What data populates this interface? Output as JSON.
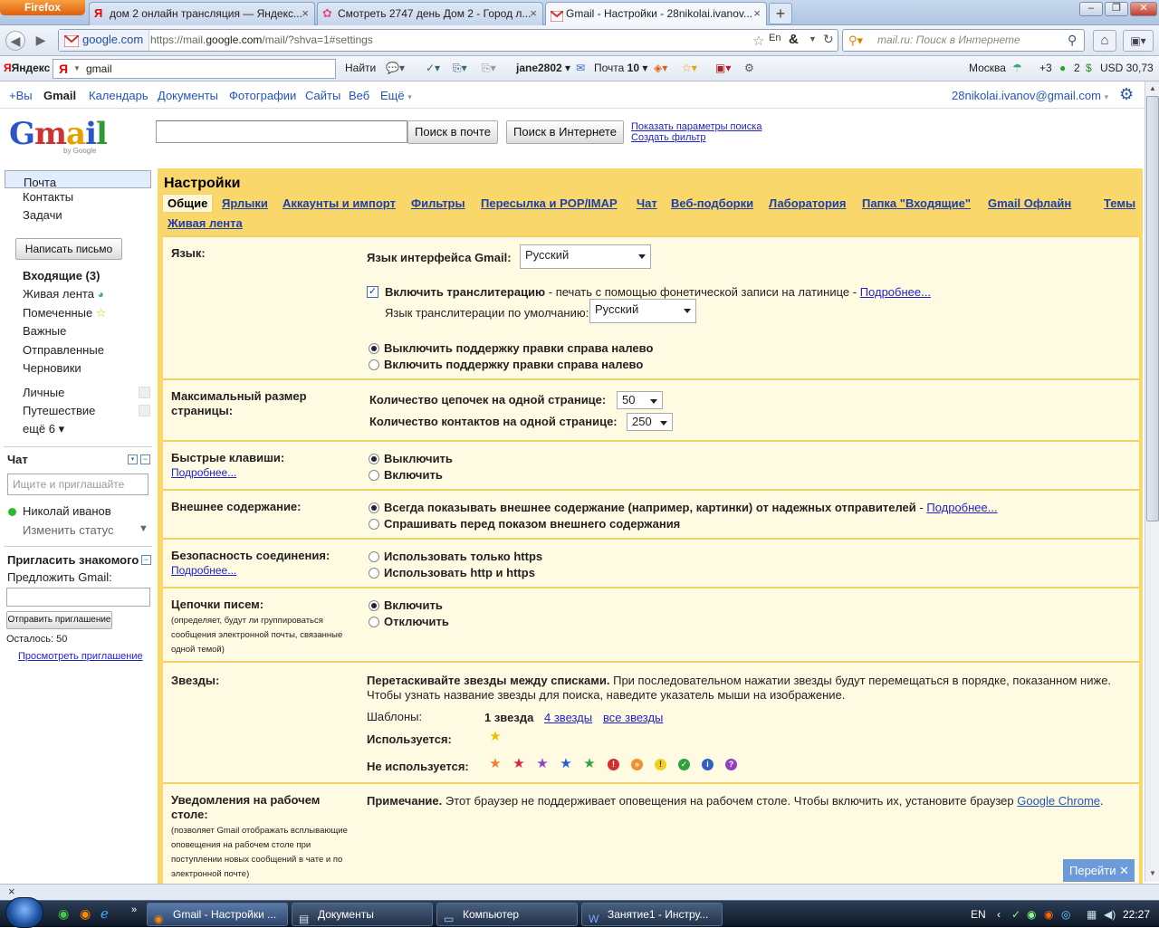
{
  "browser": {
    "app_button": "Firefox",
    "tabs": [
      {
        "label": "дом 2 онлайн трансляция — Яндекс...",
        "active": false
      },
      {
        "label": "Смотреть 2747 день Дом 2 - Город л...",
        "active": false
      },
      {
        "label": "Gmail - Настройки - 28nikolai.ivanov...",
        "active": true
      }
    ],
    "site_identity": "google.com",
    "url_prefix": "https://mail.",
    "url_host": "google.com",
    "url_path": "/mail/?shva=1#settings",
    "search_placeholder": "mail.ru: Поиск в Интернете"
  },
  "yandex_bar": {
    "brand": "Яндекс",
    "query": "gmail",
    "find": "Найти",
    "user": "jane2802",
    "mail": "Почта",
    "mail_count": "10",
    "city": "Москва",
    "temp": "+3",
    "traffic": "2",
    "currency": "USD 30,73"
  },
  "google_bar": {
    "links": [
      "+Вы",
      "Gmail",
      "Календарь",
      "Документы",
      "Фотографии",
      "Сайты",
      "Веб",
      "Ещё"
    ],
    "account": "28nikolai.ivanov@gmail.com"
  },
  "search": {
    "mail_button": "Поиск в почте",
    "web_button": "Поиск в Интернете",
    "show_options": "Показать параметры поиска",
    "create_filter": "Создать фильтр",
    "logo_sub": "by Google"
  },
  "sidebar": {
    "top_items": [
      "Почта",
      "Контакты",
      "Задачи"
    ],
    "compose": "Написать письмо",
    "folders": [
      "Входящие (3)",
      "Живая лента",
      "Помеченные",
      "Важные",
      "Отправленные",
      "Черновики"
    ],
    "labels": [
      "Личные",
      "Путешествие"
    ],
    "more": "ещё 6 ▾",
    "chat_title": "Чат",
    "chat_search_placeholder": "Ищите и приглашайте",
    "chat_user": "Николай иванов",
    "change_status": "Изменить статус",
    "invite_title": "Пригласить знакомого",
    "invite_prompt": "Предложить Gmail:",
    "invite_button": "Отправить приглашение",
    "invites_left": "Осталось: 50",
    "view_invites": "Просмотреть приглашение"
  },
  "settings": {
    "title": "Настройки",
    "tabs": [
      "Общие",
      "Ярлыки",
      "Аккаунты и импорт",
      "Фильтры",
      "Пересылка и POP/IMAP",
      "Чат",
      "Веб-подборки",
      "Лаборатория",
      "Папка \"Входящие\"",
      "Gmail Офлайн",
      "Темы",
      "Живая лента"
    ],
    "language": {
      "label": "Язык:",
      "ui_lang_label": "Язык интерфейса Gmail:",
      "ui_lang_value": "Русский",
      "translit_bold": "Включить транслитерацию",
      "translit_rest": " - печать с помощью фонетической записи на латинице - ",
      "more": "Подробнее...",
      "translit_default_label": "Язык транслитерации по умолчанию:",
      "translit_default_value": "Русский",
      "rtl_off": "Выключить поддержку правки справа налево",
      "rtl_on": "Включить поддержку правки справа налево"
    },
    "page_size": {
      "label": "Максимальный размер страницы:",
      "threads_label": "Количество цепочек на одной странице:",
      "threads_value": "50",
      "contacts_label": "Количество контактов на одной странице:",
      "contacts_value": "250"
    },
    "shortcuts": {
      "label": "Быстрые клавиши:",
      "more": "Подробнее...",
      "off": "Выключить",
      "on": "Включить"
    },
    "external": {
      "label": "Внешнее содержание:",
      "always": "Всегда показывать внешнее содержание (например, картинки) от надежных отправителей",
      "sep": " - ",
      "more": "Подробнее...",
      "ask": "Спрашивать перед показом внешнего содержания"
    },
    "security": {
      "label": "Безопасность соединения:",
      "more": "Подробнее...",
      "https_only": "Использовать только https",
      "both": "Использовать http и https"
    },
    "threads": {
      "label": "Цепочки писем:",
      "note": "(определяет, будут ли группироваться сообщения электронной почты, связанные одной темой)",
      "on": "Включить",
      "off": "Отключить"
    },
    "stars": {
      "label": "Звезды:",
      "desc_bold": "Перетаскивайте звезды между списками.",
      "desc_rest": " При последовательном нажатии звезды будут перемещаться в порядке, показанном ниже. Чтобы узнать название звезды для поиска, наведите указатель мыши на изображение.",
      "presets_label": "Шаблоны:",
      "preset_1": "1 звезда",
      "preset_4": "4 звезды",
      "preset_all": "все звезды",
      "in_use": "Используется:",
      "not_in_use": "Не используется:"
    },
    "desktop": {
      "label": "Уведомления на рабочем столе:",
      "note": "(позволяет Gmail отображать всплывающие оповещения на рабочем столе при поступлении новых сообщений в чате и по электронной почте)",
      "note_bold": "Примечание.",
      "note_rest": " Этот браузер не поддерживает оповещения на рабочем столе. Чтобы включить их, установите браузер ",
      "chrome": "Google Chrome",
      "dot": "."
    }
  },
  "goto_button": "Перейти",
  "taskbar": {
    "items": [
      "Gmail - Настройки ...",
      "Документы",
      "Компьютер",
      "Занятие1 - Инстру..."
    ],
    "lang": "EN",
    "clock": "22:27"
  }
}
